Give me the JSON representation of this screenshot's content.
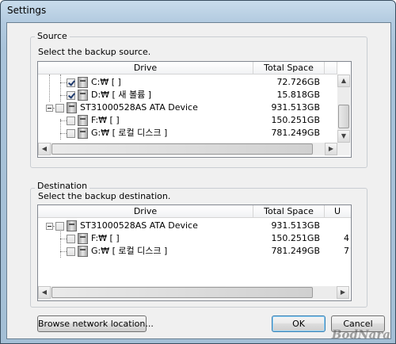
{
  "window": {
    "title": "Settings"
  },
  "source": {
    "group_label": "Source",
    "instruction": "Select the backup source.",
    "columns": [
      "Drive",
      "Total Space",
      ""
    ],
    "rows": [
      {
        "label": "C:₩ [  ]",
        "size": "72.726GB",
        "checked": true
      },
      {
        "label": "D:₩ [ 새 볼륨 ]",
        "size": "15.818GB",
        "checked": true
      },
      {
        "label": "ST31000528AS ATA Device",
        "size": "931.513GB",
        "checked": false
      },
      {
        "label": "F:₩ [  ]",
        "size": "150.251GB",
        "checked": false
      },
      {
        "label": "G:₩ [ 로컬 디스크 ]",
        "size": "781.249GB",
        "checked": false
      }
    ]
  },
  "destination": {
    "group_label": "Destination",
    "instruction": "Select the backup destination.",
    "columns": [
      "Drive",
      "Total Space",
      "U"
    ],
    "rows": [
      {
        "label": "ST31000528AS ATA Device",
        "size": "931.513GB",
        "extra": "",
        "checked": false
      },
      {
        "label": "F:₩ [  ]",
        "size": "150.251GB",
        "extra": "4",
        "checked": false
      },
      {
        "label": "G:₩ [ 로컬 디스크 ]",
        "size": "781.249GB",
        "extra": "7",
        "checked": false
      }
    ]
  },
  "buttons": {
    "browse": "Browse network location...",
    "ok": "OK",
    "cancel": "Cancel"
  },
  "icons": {
    "scroll_up": "▲",
    "scroll_down": "▼",
    "scroll_left": "◀",
    "scroll_right": "▶"
  },
  "watermark": "BodNara"
}
